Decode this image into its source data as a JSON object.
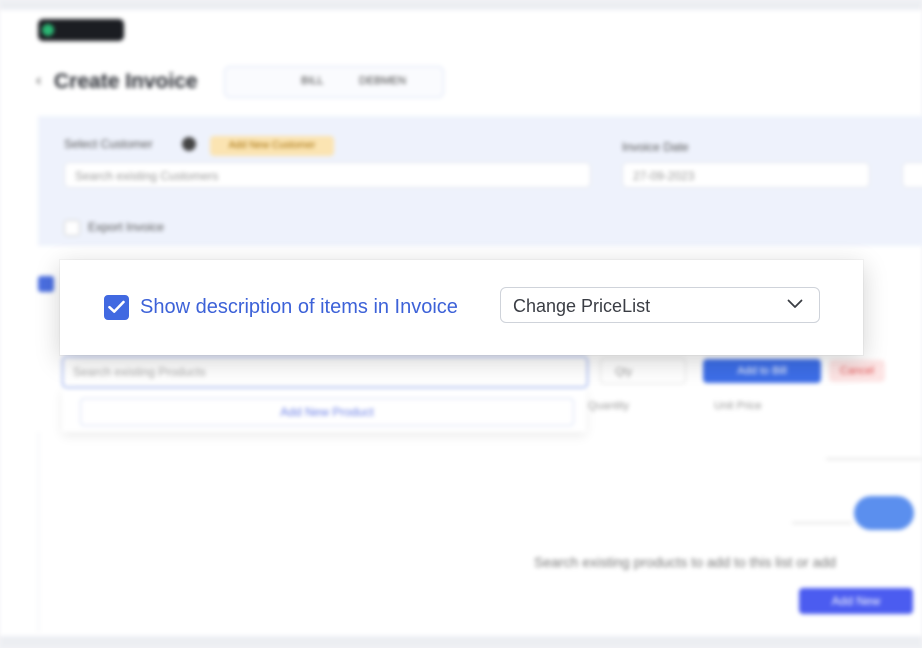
{
  "background": {
    "page_title": "Create Invoice",
    "type_tabs": [
      "BILL",
      "DEBMEN"
    ],
    "customer_label": "Select Customer",
    "add_customer_badge": "Add New Customer",
    "customer_placeholder": "Search existing Customers",
    "date_label": "Invoice Date",
    "date_value": "27-09-2023",
    "export_label": "Export Invoice",
    "product_placeholder": "Search existing Products",
    "add_new_product": "Add New Product",
    "qty_placeholder": "Qty",
    "add_to_bill": "Add to Bill",
    "cancel_label": "Cancel",
    "col_quantity": "Quantity",
    "col_unit_price": "Unit Price",
    "empty_message": "Search existing products to add to this list or add",
    "add_new_button": "Add New"
  },
  "overlay": {
    "checkbox_checked": true,
    "checkbox_label": "Show description of items in Invoice",
    "pricelist_select": {
      "value": "Change PriceList"
    }
  },
  "colors": {
    "accent": "#4169e1",
    "label_blue": "#3d62d8",
    "form_bg": "#eef2fc"
  },
  "icons": {
    "checkbox": "check-icon",
    "select": "chevron-down-icon"
  }
}
